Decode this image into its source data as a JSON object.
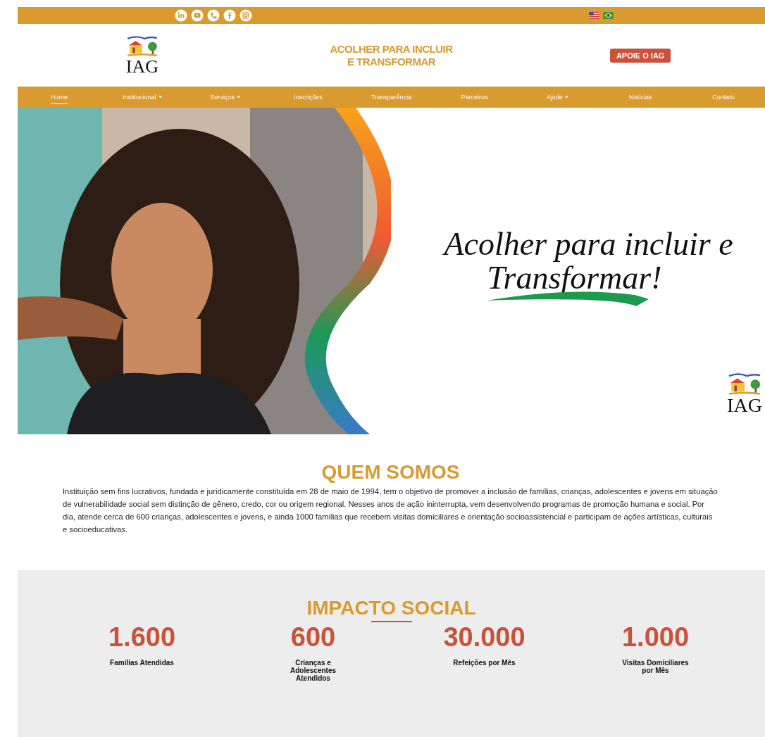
{
  "top_bar": {
    "social": [
      {
        "kind": "linkedin"
      },
      {
        "kind": "youtube"
      },
      {
        "kind": "phone"
      },
      {
        "kind": "facebook"
      },
      {
        "kind": "instagram"
      }
    ],
    "languages": [
      {
        "kind": "us"
      },
      {
        "kind": "br"
      }
    ]
  },
  "header": {
    "logo": "IAG",
    "tagline": [
      "ACOLHER PARA INCLUIR",
      "E TRANSFORMAR"
    ],
    "cta": "APOIE O IAG"
  },
  "nav": [
    {
      "label": "Home",
      "selected": true,
      "dropdown": false
    },
    {
      "label": "Institucional",
      "selected": false,
      "dropdown": true
    },
    {
      "label": "Serviços",
      "selected": false,
      "dropdown": true
    },
    {
      "label": "Inscrições",
      "selected": false,
      "dropdown": false
    },
    {
      "label": "Transparência",
      "selected": false,
      "dropdown": false
    },
    {
      "label": "Parceiros",
      "selected": false,
      "dropdown": false
    },
    {
      "label": "Ajude",
      "selected": false,
      "dropdown": true
    },
    {
      "label": "Notícias",
      "selected": false,
      "dropdown": false
    },
    {
      "label": "Contato",
      "selected": false,
      "dropdown": false
    }
  ],
  "hero": {
    "headline": [
      "Acolher para incluir e",
      "Transformar!"
    ],
    "logo": "IAG"
  },
  "about": {
    "title": "QUEM SOMOS",
    "text": "Instituição sem fins lucrativos, fundada e juridicamente constituída em 28 de maio de 1994, tem o objetivo de promover a inclusão de famílias, crianças, adolescentes e jovens em situação de vulnerabilidade social sem distinção de gênero, credo, cor ou origem regional. Nesses anos de ação ininterrupta, vem desenvolvendo programas de promoção humana e social. Por dia, atende cerca de 600 crianças, adolescentes e jovens, e ainda 1000 famílias que recebem visitas domiciliares e orientação socioassistencial e participam de ações artísticas, culturais e socioeducativas."
  },
  "impact": {
    "title": "IMPACTO SOCIAL",
    "stats": [
      {
        "value": "1.600",
        "lines": [
          "Famílias Atendidas"
        ]
      },
      {
        "value": "600",
        "lines": [
          "Crianças e",
          "Adolescentes",
          "Atendidos"
        ]
      },
      {
        "value": "30.000",
        "lines": [
          "Refeições por Mês"
        ]
      },
      {
        "value": "1.000",
        "lines": [
          "Visitas Domiciliares",
          "por Mês"
        ]
      }
    ]
  }
}
